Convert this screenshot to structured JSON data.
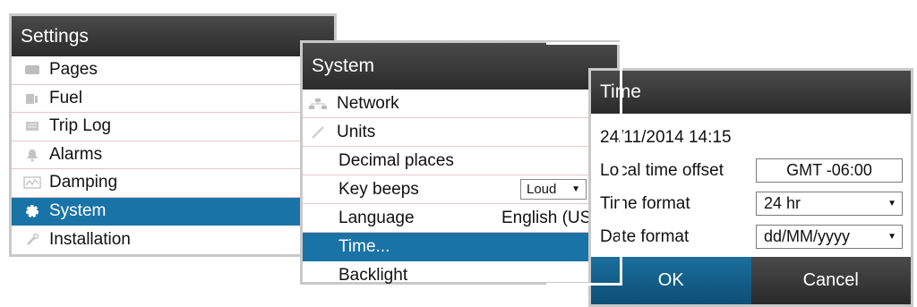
{
  "settings": {
    "title": "Settings",
    "items": [
      {
        "label": "Pages",
        "icon": "pages-icon"
      },
      {
        "label": "Fuel",
        "icon": "fuel-icon"
      },
      {
        "label": "Trip Log",
        "icon": "trip-log-icon"
      },
      {
        "label": "Alarms",
        "icon": "bell-icon"
      },
      {
        "label": "Damping",
        "icon": "damping-icon"
      },
      {
        "label": "System",
        "icon": "gear-icon",
        "selected": true
      },
      {
        "label": "Installation",
        "icon": "wrench-icon"
      }
    ]
  },
  "system": {
    "title": "System",
    "items": [
      {
        "label": "Network",
        "icon": "network-icon"
      },
      {
        "label": "Units",
        "icon": "pencil-icon"
      },
      {
        "label": "Decimal places"
      },
      {
        "label": "Key beeps",
        "control": {
          "value": "Loud"
        }
      },
      {
        "label": "Language",
        "value": "English (US)"
      },
      {
        "label": "Time...",
        "selected": true
      },
      {
        "label": "Backlight"
      }
    ]
  },
  "time": {
    "title": "Time",
    "datetime": "24/11/2014 14:15",
    "fields": [
      {
        "label": "Local time offset",
        "value": "GMT -06:00"
      },
      {
        "label": "Time format",
        "value": "24 hr"
      },
      {
        "label": "Date format",
        "value": "dd/MM/yyyy"
      }
    ],
    "ok_label": "OK",
    "cancel_label": "Cancel"
  },
  "colors": {
    "selected": "#1a73a6",
    "header": "#2b2b2b",
    "divider": "#e6c7c7"
  }
}
